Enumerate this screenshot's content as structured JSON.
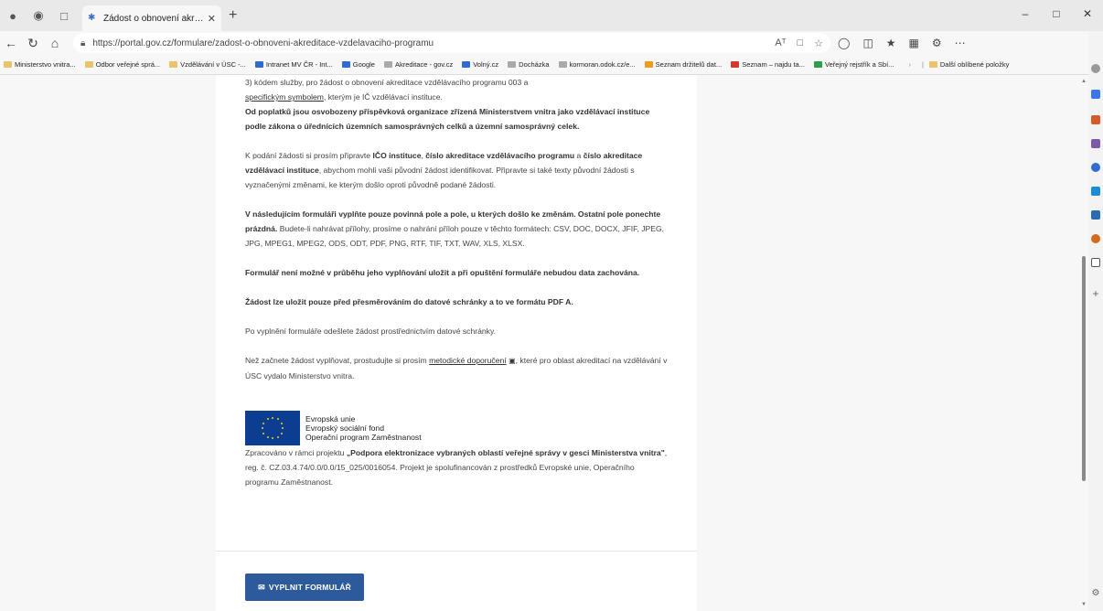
{
  "browser": {
    "tab_title": "Žádost o obnovení akreditace vz…",
    "url": "https://portal.gov.cz/formulare/zadost-o-obnoveni-akreditace-vzdelavaciho-programu",
    "reader_icon": "Aᵀ",
    "bookmarks": [
      {
        "label": "Ministerstvo vnitra...",
        "icon": "folder"
      },
      {
        "label": "Odbor veřejné sprá...",
        "icon": "folder"
      },
      {
        "label": "Vzdělávání v ÚSC -...",
        "icon": "folder"
      },
      {
        "label": "Intranet MV ČR - Int...",
        "icon": "blue"
      },
      {
        "label": "Google",
        "icon": "blue"
      },
      {
        "label": "Akreditace - gov.cz",
        "icon": "gray"
      },
      {
        "label": "Volný.cz",
        "icon": "blue"
      },
      {
        "label": "Docházka",
        "icon": "gray"
      },
      {
        "label": "kormoran.odok.cz/e...",
        "icon": "gray"
      },
      {
        "label": "Seznam držitelů dat...",
        "icon": "orange"
      },
      {
        "label": "Seznam – najdu ta...",
        "icon": "red"
      },
      {
        "label": "Veřejný rejstřík a Sbí...",
        "icon": "green"
      }
    ],
    "more_bookmarks": "Další oblíbené položky"
  },
  "content": {
    "p1_line1": "3) kódem služby, pro žádost o obnovení akreditace vzdělávacího programu 003 a",
    "p1_link": "specifickým symbolem",
    "p1_rest": ", kterým je IČ vzdělávací instituce.",
    "p1_bold": "Od poplatků jsou osvobozeny příspěvková organizace zřízená Ministerstvem vnitra jako vzdělávací instituce podle zákona o úřednících územních samosprávných celků a územní samosprávný celek.",
    "p2_a": "K podání žádosti si prosím připravte ",
    "p2_b1": "IČO instituce",
    "p2_c": ", ",
    "p2_b2": "číslo akreditace vzdělávacího programu",
    "p2_d": " a ",
    "p2_b3": "číslo akreditace vzdělávací instituce",
    "p2_e": ", abychom mohli vaši původní žádost identifikovat. Připravte si také texty původní žádosti s vyznačenými změnami, ke kterým došlo oproti původně podané žádosti.",
    "p3_bold": "V následujícím formuláři vyplňte pouze povinná pole a pole, u kterých došlo ke změnám. Ostatní pole ponechte prázdná.",
    "p3_rest": " Budete-li nahrávat přílohy, prosíme o nahrání příloh pouze v těchto formátech: CSV, DOC, DOCX, JFIF, JPEG, JPG, MPEG1, MPEG2, ODS, ODT, PDF, PNG, RTF, TIF, TXT, WAV, XLS, XLSX.",
    "p4_bold": "Formulář není možné v průběhu jeho vyplňování uložit a při opuštění formuláře nebudou data zachována.",
    "p5_bold": "Žádost lze uložit pouze před přesměrováním do datové schránky a to ve formátu PDF A.",
    "p6": "Po vyplnění formuláře odešlete žádost prostřednictvím datové schránky.",
    "p7_a": "Než začnete žádost vyplňovat, prostudujte si prosím ",
    "p7_link": "metodické doporučení",
    "p7_rest": ", které pro oblast akreditací na vzdělávání v ÚSC vydalo Ministerstvo vnitra.",
    "eu_line1": "Evropská unie",
    "eu_line2": "Evropský sociální fond",
    "eu_line3": "Operační program Zaměstnanost",
    "foot_a": "Zpracováno v rámci projektu ",
    "foot_bold": "„Podpora elektronizace vybraných oblastí veřejné správy v gesci Ministerstva vnitra\"",
    "foot_rest": ", reg. č. CZ.03.4.74/0.0/0.0/15_025/0016054. Projekt je spolufinancován z prostředků Evropské unie, Operačního programu Zaměstnanost.",
    "button_label": "VYPLNIT FORMULÁŘ"
  },
  "colors": {
    "button": "#2d5a9b",
    "eu_flag": "#0b3d91",
    "eu_star": "#f5d20b"
  }
}
